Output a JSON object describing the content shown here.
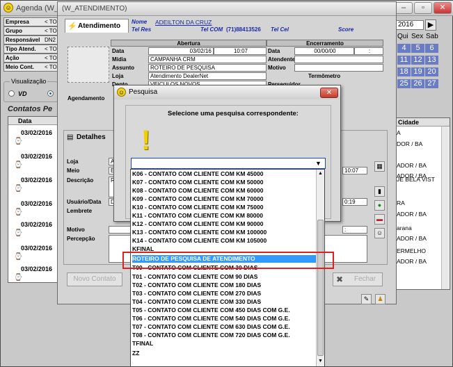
{
  "agenda": {
    "title": "Agenda (W_A",
    "fields": [
      {
        "label": "Empresa",
        "value": "< TO"
      },
      {
        "label": "Grupo",
        "value": "< TO"
      },
      {
        "label": "Responsável",
        "value": "DN2"
      },
      {
        "label": "Tipo Atend.",
        "value": "< TO"
      },
      {
        "label": "Ação",
        "value": "< TO"
      },
      {
        "label": "Meio Cont.",
        "value": "< TO"
      }
    ],
    "visualizacao_label": "Visualização",
    "vd_label": "VD",
    "contatos_title": "Contatos Pe",
    "data_header": "Data",
    "dates": [
      "03/02/2016",
      "03/02/2016",
      "03/02/2016",
      "03/02/2016",
      "03/02/2016",
      "03/02/2016",
      "03/02/2016"
    ],
    "novo_contato": "Novo Contato",
    "fechar": "Fechar",
    "calendar": {
      "year": "2016",
      "days_header": [
        "Qui",
        "Sex",
        "Sab"
      ],
      "weeks": [
        [
          "4",
          "5",
          "6"
        ],
        [
          "11",
          "12",
          "13"
        ],
        [
          "18",
          "19",
          "20"
        ],
        [
          "25",
          "26",
          "27"
        ]
      ]
    },
    "cidade_header": "Cidade",
    "cidades": [
      "A",
      "DOR / BA",
      "ADOR / BA",
      "ADOR / BA",
      "JE BELA VIST",
      "RA",
      "ADOR / BA",
      "arana",
      "ADOR / BA",
      "ERMELHO",
      "ADOR / BA"
    ]
  },
  "atendimento": {
    "title": "(W_ATENDIMENTO)",
    "tab_label": "Atendimento",
    "nome_label": "Nome",
    "nome_value": "ADEILTON DA CRUZ",
    "tel_res_label": "Tel Res",
    "tel_com_label": "Tel COM",
    "tel_com_value": "(71)88413526",
    "tel_cel_label": "Tel Cel",
    "score_label": "Score",
    "abertura_header": "Abertura",
    "encerramento_header": "Encerramento",
    "data_label": "Data",
    "data_value": "03/02/16",
    "hora_value": "10:07",
    "enc_data_value": "00/00/00",
    "enc_hora_value": ":",
    "midia_label": "Mídia",
    "midia_value": "CAMPANHA CRM",
    "atendente_label": "Atendente",
    "assunto_label": "Assunto",
    "assunto_value": "ROTEIRO DE PESQUISA",
    "motivo_label": "Motivo",
    "loja_label": "Loja",
    "loja_value": "Atendimento DealerNet",
    "termometro_label": "Termômetro",
    "depto_label": "Depto",
    "depto_value": "VEICULOS NOVOS",
    "perseguidor_label": "Perseguidor",
    "agendamento_label": "Agendamento",
    "detalhes_label": "Detalhes",
    "detalhes_rows": [
      {
        "label": "Loja",
        "value": "A"
      },
      {
        "label": "Meio",
        "value": "E"
      },
      {
        "label": "Descrição",
        "value": "R"
      },
      {
        "label": "Usuário/Data",
        "value": "D"
      },
      {
        "label": "Lembrete",
        "value": ""
      }
    ],
    "detalhes_time1": "10:07",
    "detalhes_time2": "0:19",
    "motivo2_label": "Motivo",
    "percepcao_label": "Percepção",
    "motivo2_time": ":"
  },
  "pesquisa": {
    "title": "Pesquisa",
    "prompt": "Selecione uma pesquisa correspondente:",
    "selected_value": "",
    "options": [
      "K06 - CONTATO COM CLIENTE COM KM  45000",
      "K07 - CONTATO COM CLIENTE COM KM  50000",
      "K08 - CONTATO COM CLIENTE COM KM  60000",
      "K09 - CONTATO COM CLIENTE COM KM  70000",
      "K10 - CONTATO COM CLIENTE COM KM  75000",
      "K11 - CONTATO COM CLIENTE COM KM  80000",
      "K12 - CONTATO COM CLIENTE COM KM  90000",
      "K13 - CONTATO COM CLIENTE COM KM 100000",
      "K14 - CONTATO COM CLIENTE COM KM 105000",
      "KFINAL",
      "ROTEIRO DE PESQUISA DE ATENDIMENTO",
      "T00 - CONTATO COM CLIENTE COM   30 DIAS",
      "T01 - CONTATO COM CLIENTE COM   90 DIAS",
      "T02 - CONTATO COM CLIENTE COM 180 DIAS",
      "T03 - CONTATO COM CLIENTE COM 270 DIAS",
      "T04 - CONTATO COM CLIENTE COM 330 DIAS",
      "T05 - CONTATO COM CLIENTE COM 450 DIAS    COM G.E.",
      "T06 - CONTATO COM CLIENTE COM 540 DIAS    COM G.E.",
      "T07 - CONTATO COM CLIENTE COM 630 DIAS    COM G.E.",
      "T08 - CONTATO COM CLIENTE COM 720 DIAS    COM G.E.",
      "TFINAL",
      "ZZ"
    ],
    "highlighted_index": 10,
    "highlight_color": "#3399ff",
    "annotation_color": "#e02020"
  }
}
